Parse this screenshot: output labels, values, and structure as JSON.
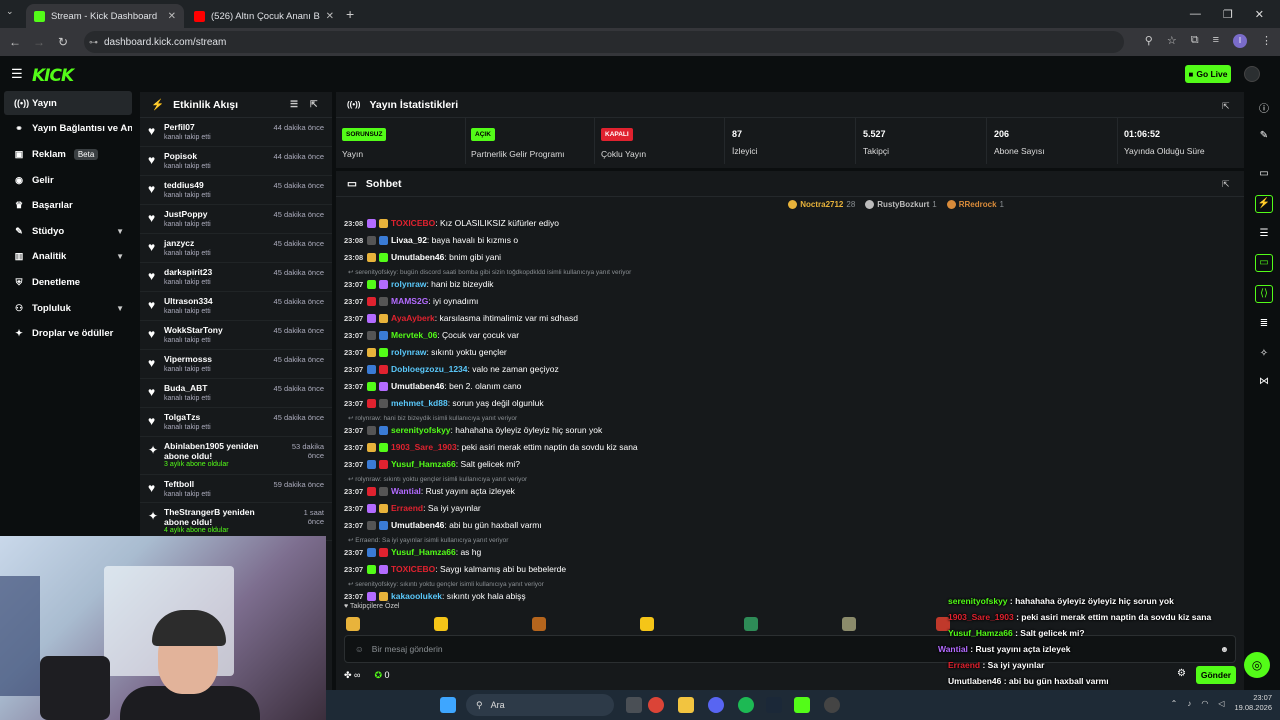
{
  "browser": {
    "tabs": [
      {
        "title": "Stream - Kick Dashboard",
        "favicon_color": "#53fc18"
      },
      {
        "title": "(526) Altın Çocuk Ananı Biçerim",
        "favicon_color": "#ff0000"
      }
    ],
    "url": "dashboard.kick.com/stream",
    "profile_initial": "I"
  },
  "header": {
    "logo": "KICK",
    "go_live": "Go Live"
  },
  "sidebar": {
    "items": [
      {
        "label": "Yayın",
        "icon": "broadcast-icon",
        "active": true
      },
      {
        "label": "Yayın Bağlantısı ve Anahtar",
        "icon": "link-icon"
      },
      {
        "label": "Reklam",
        "icon": "ad-icon",
        "badge": "Beta"
      },
      {
        "label": "Gelir",
        "icon": "dollar-icon"
      },
      {
        "label": "Başarılar",
        "icon": "trophy-icon"
      },
      {
        "label": "Stüdyo",
        "icon": "brush-icon",
        "expand": true
      },
      {
        "label": "Analitik",
        "icon": "chart-icon",
        "expand": true
      },
      {
        "label": "Denetleme",
        "icon": "shield-icon"
      },
      {
        "label": "Topluluk",
        "icon": "users-icon",
        "expand": true
      },
      {
        "label": "Droplar ve ödüller",
        "icon": "gift-icon"
      }
    ]
  },
  "activity": {
    "title": "Etkinlik Akışı",
    "items": [
      {
        "name": "Perfil07",
        "sub": "kanalı takip etti",
        "time": "44 dakika önce"
      },
      {
        "name": "Popisok",
        "sub": "kanalı takip etti",
        "time": "44 dakika önce"
      },
      {
        "name": "teddius49",
        "sub": "kanalı takip etti",
        "time": "45 dakika önce"
      },
      {
        "name": "JustPoppy",
        "sub": "kanalı takip etti",
        "time": "45 dakika önce"
      },
      {
        "name": "janzycz",
        "sub": "kanalı takip etti",
        "time": "45 dakika önce"
      },
      {
        "name": "darkspirit23",
        "sub": "kanalı takip etti",
        "time": "45 dakika önce"
      },
      {
        "name": "Ultrason334",
        "sub": "kanalı takip etti",
        "time": "45 dakika önce"
      },
      {
        "name": "WokkStarTony",
        "sub": "kanalı takip etti",
        "time": "45 dakika önce"
      },
      {
        "name": "Vipermosss",
        "sub": "kanalı takip etti",
        "time": "45 dakika önce"
      },
      {
        "name": "Buda_ABT",
        "sub": "kanalı takip etti",
        "time": "45 dakika önce"
      },
      {
        "name": "TolgaTzs",
        "sub": "kanalı takip etti",
        "time": "45 dakika önce"
      }
    ],
    "sub1": {
      "name": "Abinlaben1905 yeniden abone oldu!",
      "sub": "3 aylık abone oldular",
      "time1": "53 dakika",
      "time2": "önce"
    },
    "item12": {
      "name": "Teftboll",
      "sub": "kanalı takip etti",
      "time": "59 dakika önce"
    },
    "sub2": {
      "name": "TheStrangerB yeniden abone oldu!",
      "sub": "4 aylık abone oldular",
      "time1": "1 saat",
      "time2": "önce"
    }
  },
  "stats": {
    "title": "Yayın İstatistikleri",
    "cards": [
      {
        "pill": "SORUNSUZ",
        "pill_color": "#53fc18",
        "label": "Yayın"
      },
      {
        "pill": "AÇIK",
        "pill_color": "#53fc18",
        "label": "Partnerlik Gelir Programı"
      },
      {
        "pill": "KAPALI",
        "pill_color": "#e0222f",
        "label": "Çoklu Yayın"
      },
      {
        "value": "87",
        "label": "İzleyici"
      },
      {
        "value": "5.527",
        "label": "Takipçi"
      },
      {
        "value": "206",
        "label": "Abone Sayısı"
      },
      {
        "value": "01:06:52",
        "label": "Yayında Olduğu Süre"
      }
    ]
  },
  "chat": {
    "title": "Sohbet",
    "leaders": [
      {
        "name": "Noctra2712",
        "count": "28",
        "color": "#e8b33b"
      },
      {
        "name": "RustyBozkurt",
        "count": "1",
        "color": "#bbbbbb"
      },
      {
        "name": "RRedrock",
        "count": "1",
        "color": "#d98b3a"
      }
    ],
    "messages": [
      {
        "time": "23:08",
        "user": "TOXICEBO",
        "color": "#e0222f",
        "text": ": Kız OLASILIKSIZ küfürler ediyo"
      },
      {
        "time": "23:08",
        "user": "Livaa_92",
        "color": "#ffffff",
        "text": ": baya havalı bi kızmıs o"
      },
      {
        "time": "23:08",
        "user": "Umutlaben46",
        "color": "#ffffff",
        "text": ": bnim gibi yani"
      },
      {
        "reply": "serenityofskyy: bugün discord saati bomba gibi sizin toğdkopdkldd isimli kullanıcıya yanıt veriyor"
      },
      {
        "time": "23:07",
        "user": "rolynraw",
        "color": "#5ac8fa",
        "text": ": hani biz bizeydik"
      },
      {
        "time": "23:07",
        "user": "MAMS2G",
        "color": "#b36bff",
        "text": ": iyi oynadımı"
      },
      {
        "time": "23:07",
        "user": "AyaAyberk",
        "color": "#e0222f",
        "text": ": karsılasma ihtimalimiz var mi sdhasd"
      },
      {
        "time": "23:07",
        "user": "Mervtek_06",
        "color": "#53fc18",
        "text": ": Çocuk var çocuk var"
      },
      {
        "time": "23:07",
        "user": "rolynraw",
        "color": "#5ac8fa",
        "text": ": sıkıntı yoktu gençler"
      },
      {
        "time": "23:07",
        "user": "Dobloegzozu_1234",
        "color": "#5ac8fa",
        "text": ": valo ne zaman geçiyoz"
      },
      {
        "time": "23:07",
        "user": "Umutlaben46",
        "color": "#ffffff",
        "text": ": ben 2. olanım cano"
      },
      {
        "time": "23:07",
        "user": "mehmet_kd88",
        "color": "#5ac8fa",
        "text": ": sorun yaş değil olgunluk"
      },
      {
        "reply": "rolynraw: hani biz bizeydik isimli kullanıcıya yanıt veriyor"
      },
      {
        "time": "23:07",
        "user": "serenityofskyy",
        "color": "#53fc18",
        "text": ": hahahaha öyleyiz öyleyiz hiç sorun yok"
      },
      {
        "time": "23:07",
        "user": "1903_Sare_1903",
        "color": "#e0222f",
        "text": ": peki asiri merak ettim naptin da sovdu kiz sana"
      },
      {
        "time": "23:07",
        "user": "Yusuf_Hamza66",
        "color": "#53fc18",
        "text": ": Salt gelicek mi?"
      },
      {
        "reply": "rolynraw: sıkıntı yoktu gençler isimli kullanıcıya yanıt veriyor"
      },
      {
        "time": "23:07",
        "user": "Wantial",
        "color": "#b36bff",
        "text": ": Rust yayını açta izleyek"
      },
      {
        "time": "23:07",
        "user": "Erraend",
        "color": "#e0222f",
        "text": ": Sa iyi yayınlar"
      },
      {
        "time": "23:07",
        "user": "Umutlaben46",
        "color": "#ffffff",
        "text": ": abi bu gün haxball varmı"
      },
      {
        "reply": "Erraend: Sa iyi yayınlar isimli kullanıcıya yanıt veriyor"
      },
      {
        "time": "23:07",
        "user": "Yusuf_Hamza66",
        "color": "#53fc18",
        "text": ": as hg"
      },
      {
        "time": "23:07",
        "user": "TOXICEBO",
        "color": "#e0222f",
        "text": ": Saygı kalmamış abi bu bebelerde"
      },
      {
        "reply": "serenityofskyy: sıkıntı yoktu gençler isimli kullanıcıya yanıt veriyor"
      },
      {
        "time": "23:07",
        "user": "kakaoolukek",
        "color": "#5ac8fa",
        "text": ": sıkıntı yok hala abişş"
      }
    ],
    "emote_label": "Takipçilere Özel",
    "input_placeholder": "Bir mesaj gönderin",
    "points": "∞",
    "count": "0",
    "send": "Gönder"
  },
  "overlay": [
    {
      "user": "serenityofskyy",
      "color": "#53fc18",
      "text": " : hahahaha öyleyiz öyleyiz hiç sorun yok"
    },
    {
      "user": "1903_Sare_1903",
      "color": "#e0222f",
      "text": " : peki asiri merak ettim naptin da sovdu kiz sana"
    },
    {
      "user": "Yusuf_Hamza66",
      "color": "#53fc18",
      "text": " : Salt gelicek mi?"
    },
    {
      "user": "Wantial",
      "color": "#b36bff",
      "text": " : Rust yayını açta izleyek"
    },
    {
      "user": "Erraend",
      "color": "#e0222f",
      "text": " : Sa iyi yayınlar"
    },
    {
      "user": "Umutlaben46",
      "color": "#ffffff",
      "text": " : abi bu gün haxball varmı"
    },
    {
      "user": "Yusuf_Hamza66",
      "color": "#53fc18",
      "text": " : as hg"
    },
    {
      "user": "TOXICEBO",
      "color": "#e0222f",
      "text": " : Saygı kalmamış abi bu bebelerde"
    }
  ],
  "taskbar": {
    "search": "Ara",
    "time": "23:07",
    "date": "19.08.2026"
  }
}
